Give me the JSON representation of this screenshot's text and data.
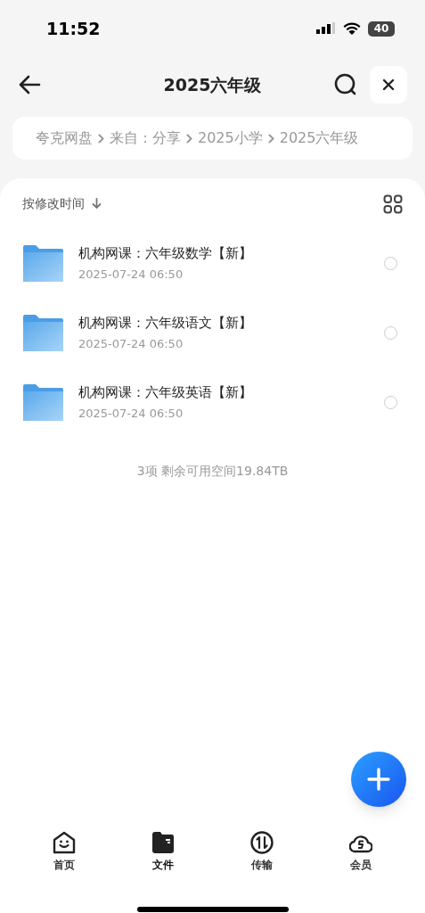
{
  "status_bar": {
    "time": "11:52",
    "battery": "40"
  },
  "header": {
    "title": "2025六年级"
  },
  "breadcrumb": [
    "夸克网盘",
    "来自：分享",
    "2025小学",
    "2025六年级"
  ],
  "sort": {
    "label": "按修改时间"
  },
  "files": [
    {
      "name": "机构网课：六年级数学【新】",
      "date": "2025-07-24 06:50",
      "selected": false
    },
    {
      "name": "机构网课：六年级语文【新】",
      "date": "2025-07-24 06:50",
      "selected": false
    },
    {
      "name": "机构网课：六年级英语【新】",
      "date": "2025-07-24 06:50",
      "selected": false
    }
  ],
  "summary": "3项 剩余可用空间19.84TB",
  "tabs": [
    {
      "kind": "home",
      "label": "首页",
      "selected": false
    },
    {
      "kind": "files",
      "label": "文件",
      "selected": true
    },
    {
      "kind": "transfer",
      "label": "传输",
      "selected": false
    },
    {
      "kind": "member",
      "label": "会员",
      "selected": false
    }
  ]
}
